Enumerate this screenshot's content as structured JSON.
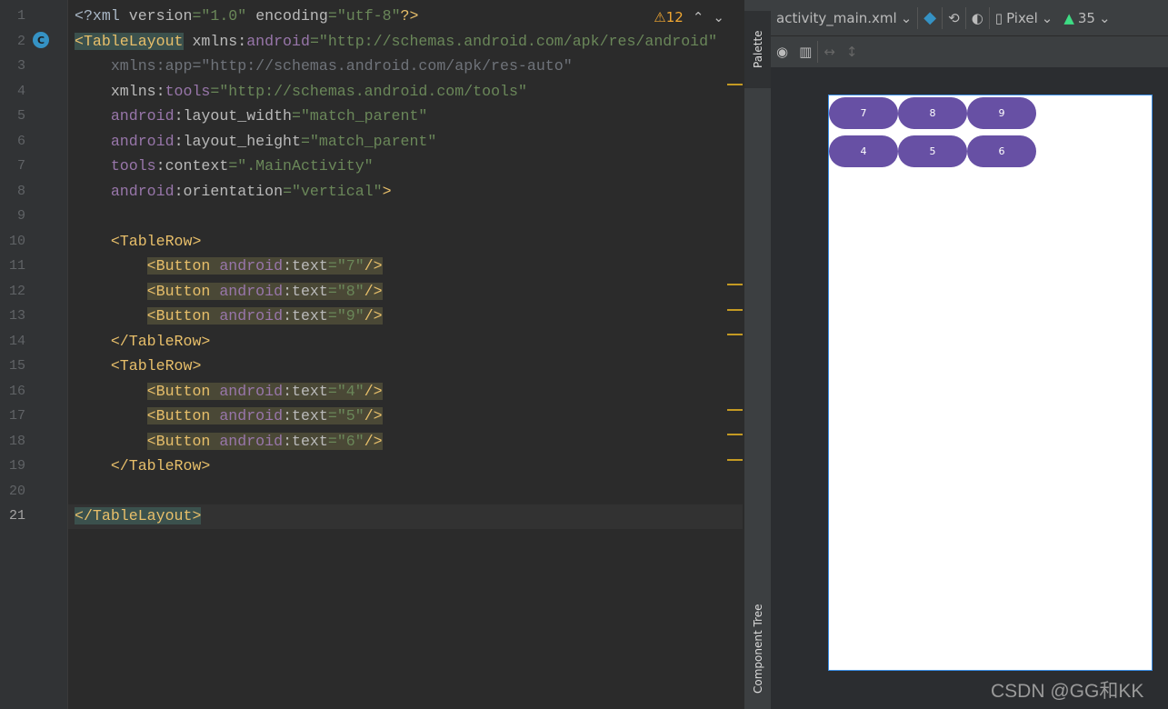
{
  "editor": {
    "current_line": 21,
    "warnings_count": "12",
    "lines": [
      [
        [
          "<?xml ",
          "t-pun"
        ],
        [
          "version",
          "t-attr"
        ],
        [
          "=\"1.0\" ",
          "t-str"
        ],
        [
          "encoding",
          "t-attr"
        ],
        [
          "=\"utf-8\"",
          "t-str"
        ],
        [
          "?>",
          "t-tag"
        ]
      ],
      [
        [
          "<TableLayout",
          "t-tag hl-tl"
        ],
        [
          " xmlns:",
          "t-attr"
        ],
        [
          "android",
          "t-ns"
        ],
        [
          "=\"http://schemas.android.com/apk/res/android\"",
          "t-str"
        ]
      ],
      [
        [
          "    xmlns:app=\"http://schemas.android.com/apk/res-auto\"",
          "t-dim"
        ]
      ],
      [
        [
          "    xmlns:",
          "t-attr"
        ],
        [
          "tools",
          "t-ns"
        ],
        [
          "=\"http://schemas.android.com/tools\"",
          "t-str"
        ]
      ],
      [
        [
          "    ",
          " "
        ],
        [
          "android",
          "t-ns"
        ],
        [
          ":layout_width",
          "t-attr"
        ],
        [
          "=\"match_parent\"",
          "t-str"
        ]
      ],
      [
        [
          "    ",
          " "
        ],
        [
          "android",
          "t-ns"
        ],
        [
          ":layout_height",
          "t-attr"
        ],
        [
          "=\"match_parent\"",
          "t-str"
        ]
      ],
      [
        [
          "    ",
          " "
        ],
        [
          "tools",
          "t-ns"
        ],
        [
          ":context",
          "t-attr"
        ],
        [
          "=\".MainActivity\"",
          "t-str"
        ]
      ],
      [
        [
          "    ",
          " "
        ],
        [
          "android",
          "t-ns"
        ],
        [
          ":orientation",
          "t-attr"
        ],
        [
          "=\"vertical\"",
          "t-str"
        ],
        [
          ">",
          "t-tag"
        ]
      ],
      [],
      [
        [
          "    ",
          " "
        ],
        [
          "<TableRow>",
          "t-tag"
        ]
      ],
      [
        [
          "        ",
          " "
        ],
        [
          "<Button ",
          "t-tag hl-btn"
        ],
        [
          "android",
          "t-ns hl-btn"
        ],
        [
          ":text",
          "t-attr hl-btn"
        ],
        [
          "=\"7\"",
          "t-str hl-btn"
        ],
        [
          "/>",
          "t-tag hl-btn"
        ]
      ],
      [
        [
          "        ",
          " "
        ],
        [
          "<Button ",
          "t-tag hl-btn"
        ],
        [
          "android",
          "t-ns hl-btn"
        ],
        [
          ":text",
          "t-attr hl-btn"
        ],
        [
          "=\"8\"",
          "t-str hl-btn"
        ],
        [
          "/>",
          "t-tag hl-btn"
        ]
      ],
      [
        [
          "        ",
          " "
        ],
        [
          "<Button ",
          "t-tag hl-btn"
        ],
        [
          "android",
          "t-ns hl-btn"
        ],
        [
          ":text",
          "t-attr hl-btn"
        ],
        [
          "=\"9\"",
          "t-str hl-btn"
        ],
        [
          "/>",
          "t-tag hl-btn"
        ]
      ],
      [
        [
          "    ",
          " "
        ],
        [
          "</TableRow>",
          "t-tag"
        ]
      ],
      [
        [
          "    ",
          " "
        ],
        [
          "<TableRow>",
          "t-tag"
        ]
      ],
      [
        [
          "        ",
          " "
        ],
        [
          "<Button ",
          "t-tag hl-btn"
        ],
        [
          "android",
          "t-ns hl-btn"
        ],
        [
          ":text",
          "t-attr hl-btn"
        ],
        [
          "=\"4\"",
          "t-str hl-btn"
        ],
        [
          "/>",
          "t-tag hl-btn"
        ]
      ],
      [
        [
          "        ",
          " "
        ],
        [
          "<Button ",
          "t-tag hl-btn"
        ],
        [
          "android",
          "t-ns hl-btn"
        ],
        [
          ":text",
          "t-attr hl-btn"
        ],
        [
          "=\"5\"",
          "t-str hl-btn"
        ],
        [
          "/>",
          "t-tag hl-btn"
        ]
      ],
      [
        [
          "        ",
          " "
        ],
        [
          "<Button ",
          "t-tag hl-btn"
        ],
        [
          "android",
          "t-ns hl-btn"
        ],
        [
          ":text",
          "t-attr hl-btn"
        ],
        [
          "=\"6\"",
          "t-str hl-btn"
        ],
        [
          "/>",
          "t-tag hl-btn"
        ]
      ],
      [
        [
          "    ",
          " "
        ],
        [
          "</TableRow>",
          "t-tag"
        ]
      ],
      [],
      [
        [
          "</TableLayout>",
          "t-tag hl-tl"
        ]
      ]
    ]
  },
  "side_tabs": {
    "palette": "Palette",
    "component_tree": "Component Tree"
  },
  "design_toolbar": {
    "file": "activity_main.xml",
    "device": "Pixel",
    "api": "35"
  },
  "preview": {
    "rows": [
      [
        "7",
        "8",
        "9"
      ],
      [
        "4",
        "5",
        "6"
      ]
    ],
    "button_color": "#6750a4"
  },
  "watermark": "CSDN @GG和KK"
}
